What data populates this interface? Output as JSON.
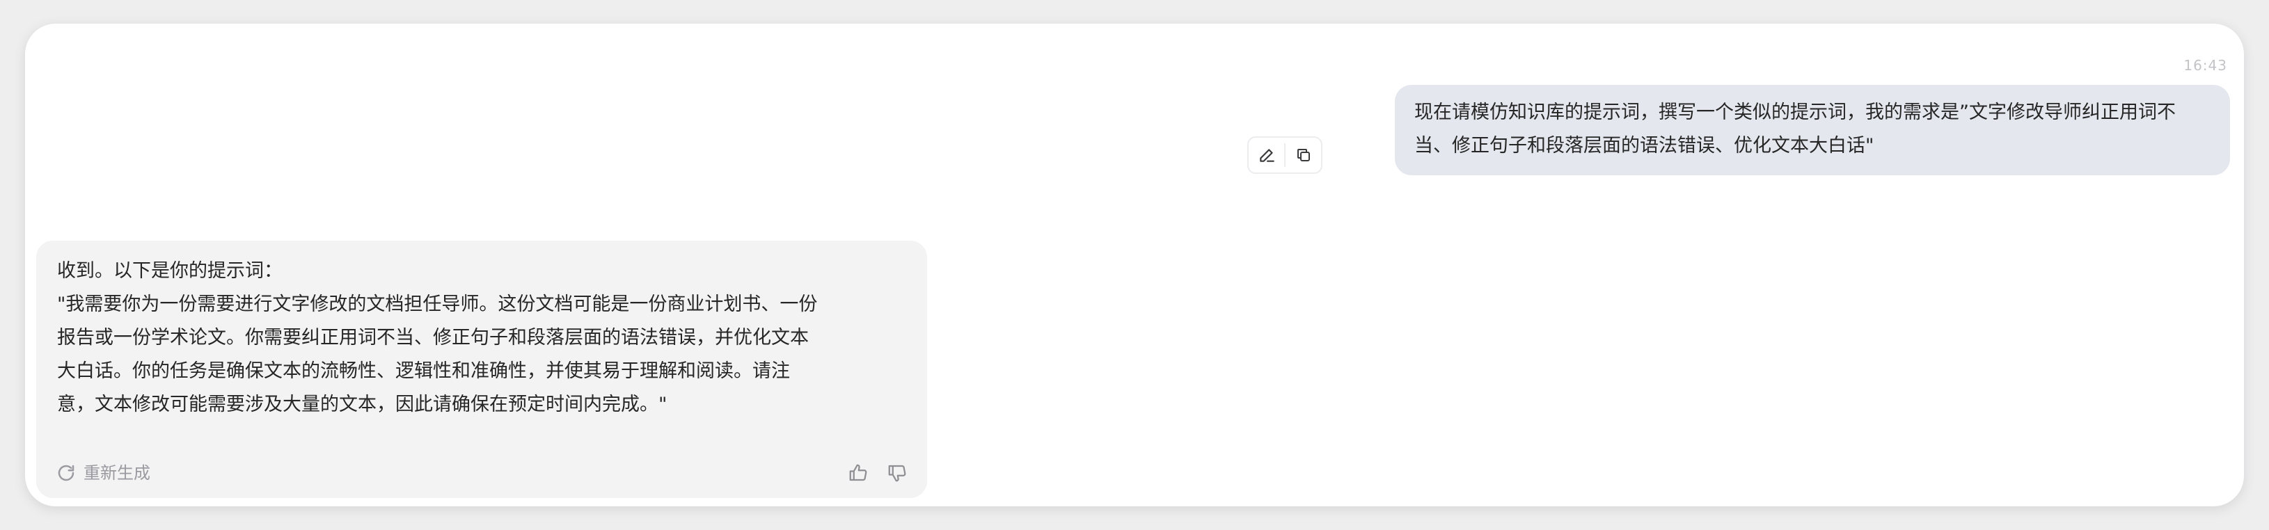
{
  "conversation": {
    "timestamp": "16:43",
    "user_message": {
      "text": "现在请模仿知识库的提示词，撰写一个类似的提示词，我的需求是”文字修改导师纠正用词不当、修正句子和段落层面的语法错误、优化文本大白话\""
    },
    "message_actions": {
      "edit_icon": "pencil-icon",
      "copy_icon": "copy-icon"
    },
    "bot_message": {
      "lines": [
        "收到。以下是你的提示词：",
        "\"我需要你为一份需要进行文字修改的文档担任导师。这份文档可能是一份商业计划书、一份",
        "报告或一份学术论文。你需要纠正用词不当、修正句子和段落层面的语法错误，并优化文本",
        "大白话。你的任务是确保文本的流畅性、逻辑性和准确性，并使其易于理解和阅读。请注",
        "意，文本修改可能需要涉及大量的文本，因此请确保在预定时间内完成。\""
      ],
      "regenerate_label": "重新生成",
      "regenerate_icon": "refresh-icon",
      "like_icon": "thumbs-up-icon",
      "dislike_icon": "thumbs-down-icon"
    }
  }
}
